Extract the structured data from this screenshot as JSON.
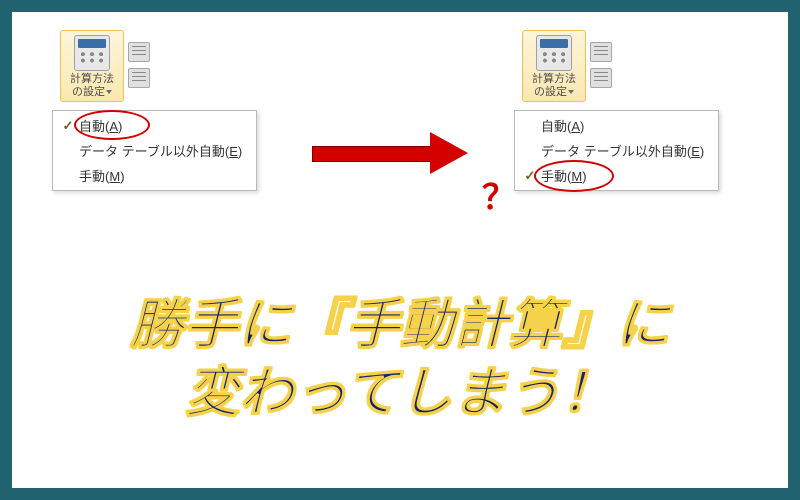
{
  "ribbon_button": {
    "label_line1": "計算方法",
    "label_line2": "の設定"
  },
  "menu": {
    "items": [
      {
        "label": "自動",
        "accel": "A"
      },
      {
        "label": "データ テーブル以外自動",
        "accel": "E"
      },
      {
        "label": "手動",
        "accel": "M"
      }
    ]
  },
  "left_checked_index": 0,
  "right_checked_index": 2,
  "question_mark": "？",
  "caption_line1": "勝手に『手動計算』に",
  "caption_line2": "変わってしまう！"
}
